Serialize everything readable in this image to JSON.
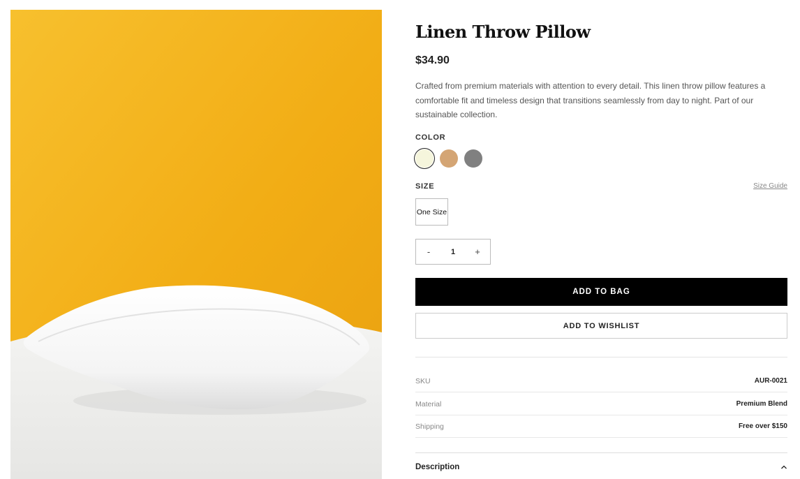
{
  "product": {
    "title": "Linen Throw Pillow",
    "price": "$34.90",
    "description": "Crafted from premium materials with attention to every detail. This linen throw pillow features a comfortable fit and timeless design that transitions seamlessly from day to night. Part of our sustainable collection.",
    "image_alt": "White pillow on a white surface against a yellow background"
  },
  "color": {
    "label": "COLOR",
    "swatches": [
      {
        "name": "cream",
        "hex": "#f5f5dc",
        "selected": true
      },
      {
        "name": "tan",
        "hex": "#d4a574",
        "selected": false
      },
      {
        "name": "gray",
        "hex": "#808080",
        "selected": false
      }
    ]
  },
  "size": {
    "label": "SIZE",
    "guide_link": "Size Guide",
    "options": [
      "One Size"
    ]
  },
  "quantity": {
    "minus": "-",
    "value": "1",
    "plus": "+"
  },
  "actions": {
    "add_to_bag": "ADD TO BAG",
    "add_to_wishlist": "ADD TO WISHLIST"
  },
  "meta": [
    {
      "key": "SKU",
      "value": "AUR-0021"
    },
    {
      "key": "Material",
      "value": "Premium Blend"
    },
    {
      "key": "Shipping",
      "value": "Free over $150"
    }
  ],
  "accordion": {
    "label": "Description",
    "icon": "chevron-up-icon"
  },
  "colors": {
    "image_background": "#f5b51a",
    "button_dark": "#000000"
  }
}
